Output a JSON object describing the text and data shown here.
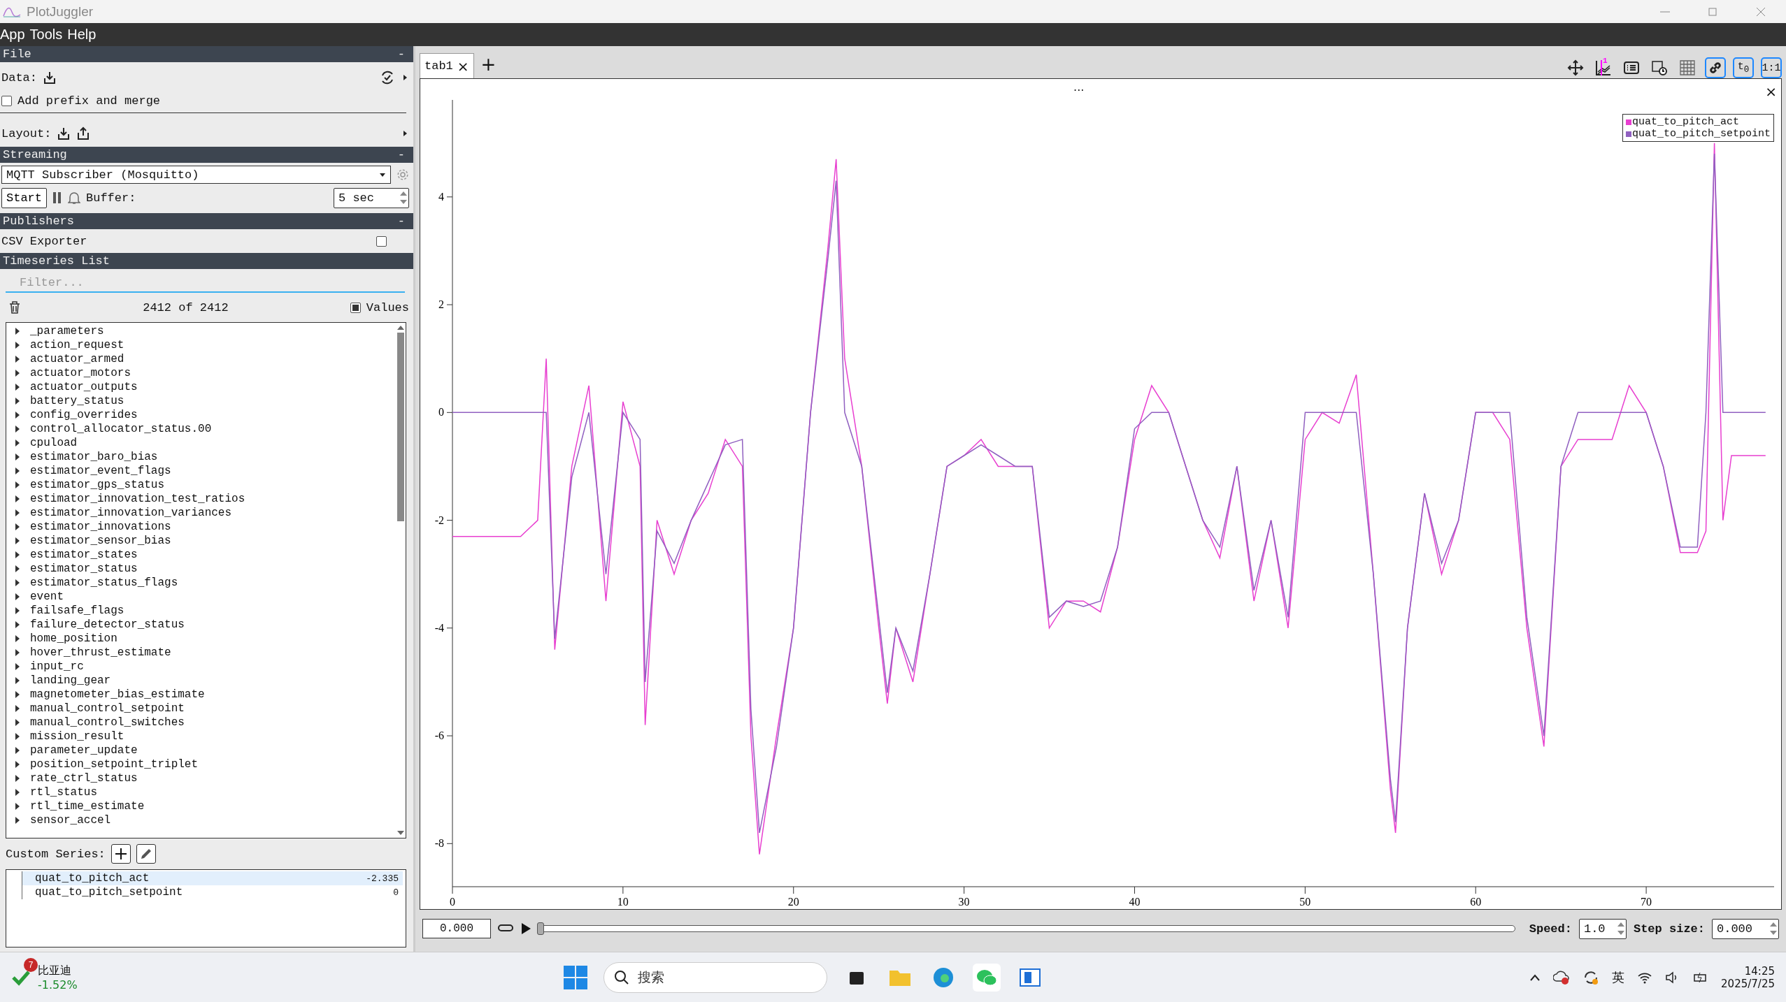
{
  "window": {
    "title": "PlotJuggler"
  },
  "menu": [
    "App",
    "Tools",
    "Help"
  ],
  "file_section": {
    "title": "File",
    "collapse": "-",
    "data_label": "Data:",
    "prefix_label": "Add prefix and merge",
    "prefix_checked": false,
    "layout_label": "Layout:"
  },
  "streaming_section": {
    "title": "Streaming",
    "collapse": "-",
    "source": "MQTT Subscriber (Mosquitto)",
    "start": "Start",
    "buffer_label": "Buffer:",
    "buffer_value": "5 sec"
  },
  "publishers_section": {
    "title": "Publishers",
    "collapse": "-",
    "items": [
      {
        "label": "CSV Exporter",
        "checked": false
      }
    ]
  },
  "timeseries_section": {
    "title": "Timeseries List",
    "filter_placeholder": "Filter...",
    "count": "2412 of 2412",
    "values_label": "Values",
    "values_checked": true,
    "items": [
      {
        "label": "_parameters",
        "expanded": false
      },
      {
        "label": "action_request",
        "expanded": false
      },
      {
        "label": "actuator_armed",
        "expanded": false
      },
      {
        "label": "actuator_motors",
        "expanded": false
      },
      {
        "label": "actuator_outputs",
        "expanded": false
      },
      {
        "label": "battery_status",
        "expanded": false
      },
      {
        "label": "config_overrides",
        "expanded": false
      },
      {
        "label": "control_allocator_status.00",
        "expanded": false
      },
      {
        "label": "cpuload",
        "expanded": false
      },
      {
        "label": "estimator_baro_bias",
        "expanded": false
      },
      {
        "label": "estimator_event_flags",
        "expanded": false
      },
      {
        "label": "estimator_gps_status",
        "expanded": false
      },
      {
        "label": "estimator_innovation_test_ratios",
        "expanded": false
      },
      {
        "label": "estimator_innovation_variances",
        "expanded": false
      },
      {
        "label": "estimator_innovations",
        "expanded": false
      },
      {
        "label": "estimator_sensor_bias",
        "expanded": false
      },
      {
        "label": "estimator_states",
        "expanded": false
      },
      {
        "label": "estimator_status",
        "expanded": false
      },
      {
        "label": "estimator_status_flags",
        "expanded": false
      },
      {
        "label": "event",
        "expanded": false
      },
      {
        "label": "failsafe_flags",
        "expanded": false
      },
      {
        "label": "failure_detector_status",
        "expanded": false
      },
      {
        "label": "home_position",
        "expanded": false
      },
      {
        "label": "hover_thrust_estimate",
        "expanded": false
      },
      {
        "label": "input_rc",
        "expanded": false
      },
      {
        "label": "landing_gear",
        "expanded": false
      },
      {
        "label": "magnetometer_bias_estimate",
        "expanded": false
      },
      {
        "label": "manual_control_setpoint",
        "expanded": false
      },
      {
        "label": "manual_control_switches",
        "expanded": false
      },
      {
        "label": "mission_result",
        "expanded": false
      },
      {
        "label": "parameter_update",
        "expanded": false
      },
      {
        "label": "position_setpoint_triplet",
        "expanded": false
      },
      {
        "label": "rate_ctrl_status",
        "expanded": false
      },
      {
        "label": "rtl_status",
        "expanded": false
      },
      {
        "label": "rtl_time_estimate",
        "expanded": false
      },
      {
        "label": "sensor_accel",
        "expanded": false
      }
    ]
  },
  "custom_series": {
    "label": "Custom Series:",
    "items": [
      {
        "name": "quat_to_pitch_act",
        "value": "-2.335",
        "selected": true
      },
      {
        "name": "quat_to_pitch_setpoint",
        "value": "0",
        "selected": false
      }
    ]
  },
  "tabs": [
    {
      "label": "tab1",
      "close": "×",
      "selected": true
    }
  ],
  "add_tab": "+",
  "toolbar": [
    {
      "kind": "move",
      "active": false
    },
    {
      "kind": "marker",
      "active": false,
      "text": "1"
    },
    {
      "kind": "list",
      "active": false
    },
    {
      "kind": "calendar",
      "active": false
    },
    {
      "kind": "grid",
      "active": false
    },
    {
      "kind": "link",
      "active": true
    },
    {
      "kind": "t0",
      "active": true,
      "text": "t$_{0}$"
    },
    {
      "kind": "ratio",
      "active": true,
      "text": "1:1"
    }
  ],
  "plot": {
    "menu": "...",
    "close": "×",
    "chart_data": {
      "type": "line",
      "x": [
        0,
        4,
        5,
        5.5,
        6,
        7,
        8,
        9,
        10,
        11,
        11.3,
        12,
        13,
        14,
        15,
        16,
        17,
        17.5,
        18,
        19,
        20,
        21,
        22,
        22.5,
        23,
        24,
        25,
        25.5,
        26,
        27,
        28,
        29,
        30,
        31,
        32,
        33,
        34,
        35,
        36,
        37,
        38,
        39,
        40,
        41,
        42,
        43,
        44,
        45,
        46,
        47,
        48,
        49,
        50,
        51,
        52,
        53,
        54,
        55,
        55.3,
        56,
        57,
        58,
        59,
        60,
        61,
        62,
        63,
        64,
        65,
        66,
        67,
        68,
        69,
        70,
        71,
        72,
        73,
        73.5,
        74,
        74.5,
        75,
        77
      ],
      "series": [
        {
          "name": "quat_to_pitch_act",
          "color": "#e83fd0",
          "values": [
            -2.3,
            -2.3,
            -2,
            1,
            -4.4,
            -1,
            0.5,
            -3.5,
            0.2,
            -1,
            -5.8,
            -2,
            -3,
            -2,
            -1.5,
            -0.5,
            -1,
            -6,
            -8.2,
            -6,
            -4,
            0,
            3,
            4.7,
            1,
            -1,
            -4,
            -5.4,
            -4,
            -5,
            -3,
            -1,
            -0.8,
            -0.5,
            -1,
            -1,
            -1,
            -4,
            -3.5,
            -3.5,
            -3.7,
            -2.5,
            -0.5,
            0.5,
            0,
            -1,
            -2,
            -2.7,
            -1,
            -3.5,
            -2,
            -4,
            -0.5,
            0,
            -0.2,
            0.7,
            -3,
            -7,
            -7.8,
            -4,
            -1.5,
            -3,
            -2,
            0,
            0,
            -0.5,
            -4,
            -6.2,
            -1,
            -0.5,
            -0.5,
            -0.5,
            0.5,
            0,
            -1,
            -2.6,
            -2.6,
            -2.2,
            5,
            -2,
            -0.8,
            -0.8
          ]
        },
        {
          "name": "quat_to_pitch_setpoint",
          "color": "#9060c0",
          "values": [
            0,
            0,
            0,
            0,
            -4.2,
            -1.2,
            0,
            -3,
            0,
            -0.5,
            -5,
            -2.2,
            -2.8,
            -2,
            -1.3,
            -0.6,
            -0.5,
            -5.5,
            -7.8,
            -6.2,
            -4,
            0,
            2.8,
            4.3,
            0,
            -1,
            -3.8,
            -5.2,
            -4,
            -4.8,
            -3,
            -1,
            -0.8,
            -0.6,
            -0.8,
            -1,
            -1,
            -3.8,
            -3.5,
            -3.6,
            -3.5,
            -2.5,
            -0.3,
            0,
            0,
            -1,
            -2,
            -2.5,
            -1,
            -3.3,
            -2,
            -3.8,
            0,
            0,
            0,
            0,
            -3,
            -6.8,
            -7.6,
            -4,
            -1.5,
            -2.8,
            -2,
            0,
            0,
            0,
            -3.8,
            -6,
            -1,
            0,
            0,
            0,
            0,
            0,
            -1,
            -2.5,
            -2.5,
            0,
            4.8,
            0,
            0,
            0
          ]
        }
      ],
      "xlim": [
        0,
        77.5
      ],
      "ylim": [
        -8.8,
        5.8
      ],
      "xticks": [
        0,
        10,
        20,
        30,
        40,
        50,
        60,
        70
      ],
      "yticks": [
        -8,
        -6,
        -4,
        -2,
        0,
        2,
        4
      ]
    }
  },
  "playback": {
    "time": "0.000",
    "level": 0,
    "speed_label": "Speed:",
    "speed": "1.0",
    "step_label": "Step size:",
    "step": "0.000"
  },
  "taskbar": {
    "stock_badge": "7",
    "stock_name": "比亚迪",
    "stock_change": "-1.52%",
    "search": "搜索",
    "ime": "英",
    "time": "14:25",
    "date": "2025/7/25"
  }
}
